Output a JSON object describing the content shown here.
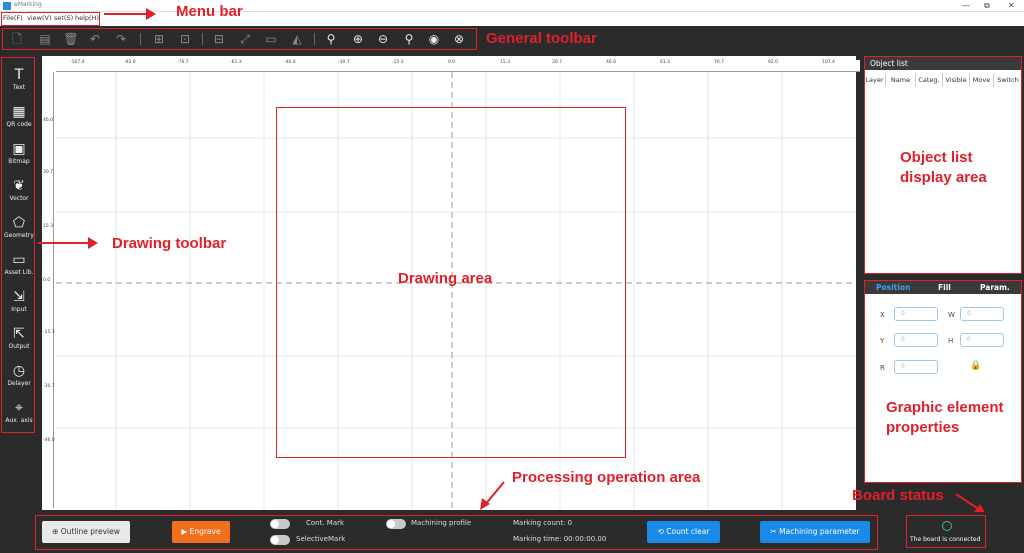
{
  "window": {
    "title": "eMarking",
    "min_icon": "—",
    "max_icon": "⧉",
    "close_icon": "✕"
  },
  "menu": [
    "File(F)",
    "view(V)",
    "set(S)",
    "help(H)"
  ],
  "toolbar_icons": [
    "new-file-icon",
    "open-file-icon",
    "delete-icon",
    "undo-icon",
    "redo-icon",
    "group-icon",
    "ungroup-icon",
    "align-icon",
    "edit-nodes-icon",
    "image-icon",
    "mirror-icon",
    "zoom-icon",
    "zoom-in-icon",
    "zoom-out-icon",
    "zoom-fit-icon",
    "zoom-all-icon",
    "zoom-reset-icon"
  ],
  "tools": [
    {
      "label": "Text",
      "icon": "T"
    },
    {
      "label": "QR code",
      "icon": "▦"
    },
    {
      "label": "Bitmap",
      "icon": "▣"
    },
    {
      "label": "Vector",
      "icon": "❦"
    },
    {
      "label": "Geometry",
      "icon": "⬠"
    },
    {
      "label": "Asset Lib.",
      "icon": "▭"
    },
    {
      "label": "Input",
      "icon": "⇲"
    },
    {
      "label": "Output",
      "icon": "⇱"
    },
    {
      "label": "Delayer",
      "icon": "◷"
    },
    {
      "label": "Aux. axis",
      "icon": "⌖"
    }
  ],
  "ruler": {
    "top": [
      "-107.4",
      "-92.0",
      "-76.7",
      "-61.3",
      "-46.0",
      "-30.7",
      "-15.3",
      "0.0",
      "15.3",
      "30.7",
      "46.0",
      "61.3",
      "76.7",
      "92.0",
      "107.4"
    ],
    "left": [
      "46.0",
      "30.7",
      "15.3",
      "0.0",
      "-15.3",
      "-30.7",
      "-46.0"
    ]
  },
  "object_list": {
    "title": "Object list",
    "columns": [
      "Layer",
      "Name",
      "Categ.",
      "Visible",
      "Move",
      "Switch"
    ]
  },
  "properties": {
    "tabs": [
      "Position",
      "Fill",
      "Param."
    ],
    "fields": [
      {
        "label": "X",
        "value": "0"
      },
      {
        "label": "W",
        "value": "0"
      },
      {
        "label": "Y",
        "value": "0"
      },
      {
        "label": "H",
        "value": "0"
      },
      {
        "label": "R",
        "value": "0"
      }
    ],
    "lock_icon": "🔒"
  },
  "bottom": {
    "outline_preview": "Outline preview",
    "engrave": "Engrave",
    "cont_mark": "Cont. Mark",
    "selective_mark": "SelectiveMark",
    "machining_profile": "Machining profile",
    "marking_count": "Marking count: 0",
    "marking_time": "Marking time: 00:00:00.00",
    "count_clear": "Count clear",
    "machining_parameter": "Machining parameter",
    "board_status": "The board is connected"
  },
  "annotations": {
    "menu_bar": "Menu bar",
    "general_toolbar": "General toolbar",
    "drawing_toolbar": "Drawing toolbar",
    "drawing_area": "Drawing area",
    "object_list_area": "Object list display area",
    "object_list_line1": "Object list",
    "object_list_line2": "display area",
    "graphic_props_line1": "Graphic element",
    "graphic_props_line2": "properties",
    "processing": "Processing operation area",
    "board_status": "Board status"
  },
  "colors": {
    "annotation": "#e0202a",
    "dark": "#2b2b2b",
    "engrave": "#f07020",
    "blue": "#1a8ae8"
  }
}
